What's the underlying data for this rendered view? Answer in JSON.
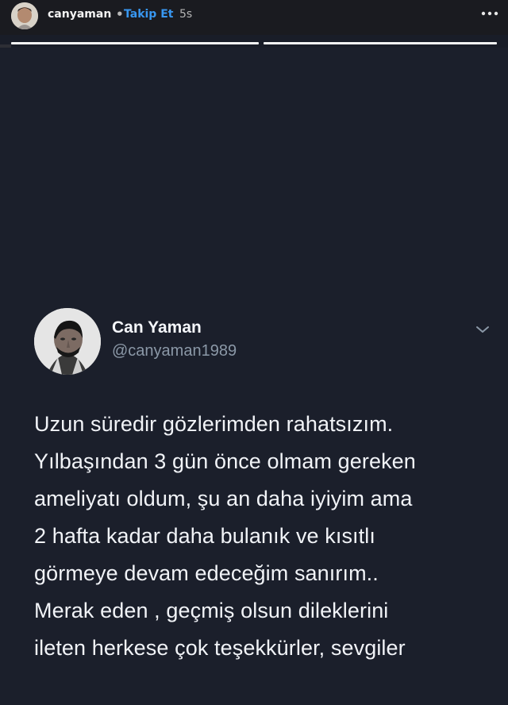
{
  "story_header": {
    "username": "canyaman",
    "separator": "•",
    "follow_label": "Takip Et",
    "time_ago": "5s",
    "more_icon": "more-dots-icon",
    "progress": [
      1.0,
      1.0
    ]
  },
  "tweet": {
    "display_name": "Can Yaman",
    "handle": "@canyaman1989",
    "avatar_icon": "profile-photo",
    "menu_icon": "chevron-down-icon",
    "lines": [
      "Uzun süredir gözlerimden rahatsızım.",
      "Yılbaşından 3 gün önce olmam gereken",
      "ameliyatı oldum, şu an daha iyiyim ama",
      "2 hafta kadar daha bulanık ve kısıtlı",
      "görmeye devam edeceğim sanırım..",
      "Merak eden , geçmiş olsun dileklerini",
      "ileten herkese çok teşekkürler, sevgiler"
    ]
  },
  "colors": {
    "background": "#1b1f2b",
    "header_bg": "#1a1b20",
    "link": "#3897f0",
    "handle": "#8b98a7",
    "text": "#f1f3f7"
  }
}
